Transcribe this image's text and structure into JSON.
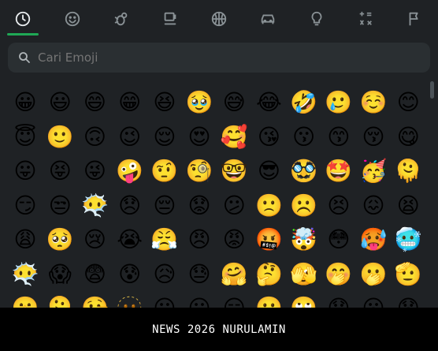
{
  "tabs": [
    {
      "name": "recent-tab",
      "icon": "clock-icon",
      "active": true
    },
    {
      "name": "smileys-tab",
      "icon": "smiley-icon"
    },
    {
      "name": "animals-tab",
      "icon": "bug-icon"
    },
    {
      "name": "food-tab",
      "icon": "cup-icon"
    },
    {
      "name": "activities-tab",
      "icon": "ball-icon"
    },
    {
      "name": "travel-tab",
      "icon": "car-icon"
    },
    {
      "name": "objects-tab",
      "icon": "bulb-icon"
    },
    {
      "name": "symbols-tab",
      "icon": "symbols-icon"
    },
    {
      "name": "flags-tab",
      "icon": "flag-icon"
    }
  ],
  "colors": {
    "active": "#1fa855",
    "icon": "#8a9296"
  },
  "search": {
    "placeholder": "Cari Emoji"
  },
  "emoji_rows": [
    [
      "😀",
      "😃",
      "😄",
      "😁",
      "😆",
      "🥹",
      "😅",
      "😂",
      "🤣",
      "🥲",
      "☺️",
      "😊"
    ],
    [
      "😇",
      "🙂",
      "🙃",
      "😉",
      "😌",
      "😍",
      "🥰",
      "😘",
      "😗",
      "😙",
      "😚",
      "😋"
    ],
    [
      "😛",
      "😝",
      "😜",
      "🤪",
      "🤨",
      "🧐",
      "🤓",
      "😎",
      "🥸",
      "🤩",
      "🥳",
      "🫠"
    ],
    [
      "😏",
      "😒",
      "😶‍🌫️",
      "😞",
      "😔",
      "😟",
      "😕",
      "🙁",
      "☹️",
      "😣",
      "😖",
      "😫"
    ],
    [
      "😩",
      "🥺",
      "😢",
      "😭",
      "😤",
      "😠",
      "😡",
      "🤬",
      "🤯",
      "😳",
      "🥵",
      "🥶"
    ],
    [
      "😶‍🌫️",
      "😱",
      "😨",
      "😰",
      "😥",
      "😓",
      "🤗",
      "🤔",
      "🫣",
      "🤭",
      "🫢",
      "🫡"
    ],
    [
      "🤫",
      "🫠",
      "🤥",
      "🫥",
      "😶",
      "😐",
      "😑",
      "😬",
      "🙄",
      "😯",
      "😦",
      "😧"
    ]
  ],
  "footer": {
    "text": "NEWS 2026 NURULAMIN"
  }
}
